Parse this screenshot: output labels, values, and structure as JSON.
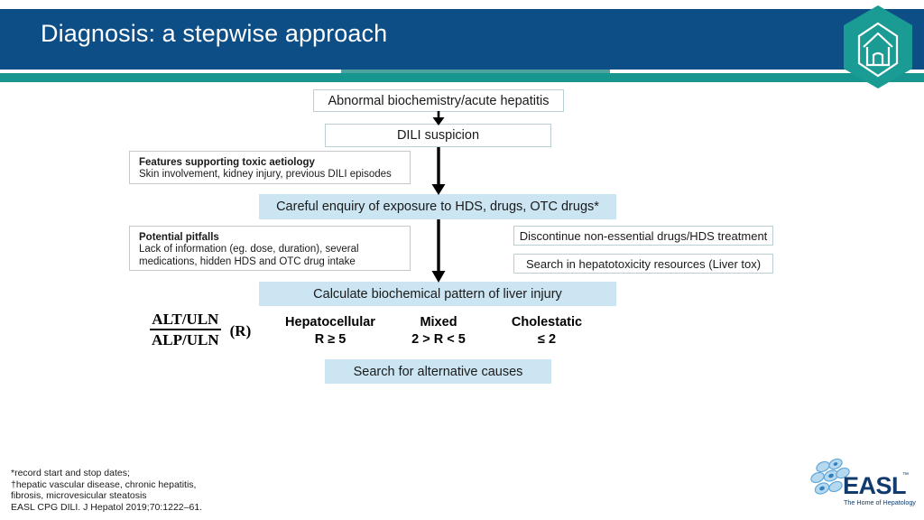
{
  "header": {
    "title": "Diagnosis: a stepwise approach",
    "bar_color": "#0d4e86",
    "band_color": "#17958f",
    "logo_name": "easl-hexagon-house-logo"
  },
  "flow": {
    "abnormal": "Abnormal biochemistry/acute hepatitis",
    "dili_suspicion": "DILI suspicion",
    "enquiry": "Careful enquiry of exposure to HDS, drugs, OTC drugs*",
    "calculate": "Calculate biochemical pattern of liver injury",
    "alternative_causes": "Search for alternative causes",
    "accent_blue": "#cce5f2"
  },
  "notes": {
    "features": {
      "title": "Features supporting toxic aetiology",
      "body": "Skin involvement, kidney injury, previous DILI episodes"
    },
    "pitfalls": {
      "title": "Potential pitfalls",
      "body": "Lack of information (eg. dose, duration), several medications, hidden HDS and OTC drug intake"
    }
  },
  "actions": {
    "discontinue": "Discontinue non-essential drugs/HDS treatment",
    "search_resources": "Search in hepatotoxicity resources (Liver tox)"
  },
  "r_ratio": {
    "numerator": "ALT/ULN",
    "denominator": "ALP/ULN",
    "label": "(R)"
  },
  "patterns": [
    {
      "name": "Hepatocellular",
      "rule": "R ≥ 5"
    },
    {
      "name": "Mixed",
      "rule": "2 > R < 5"
    },
    {
      "name": "Cholestatic",
      "rule": "≤ 2"
    }
  ],
  "footnotes": [
    "*record start and stop dates;",
    "†hepatic vascular disease, chronic hepatitis,",
    "fibrosis, microvesicular steatosis",
    "EASL CPG DILI. J Hepatol 2019;70:1222–61."
  ],
  "easl_logo": {
    "wordmark": "EASL",
    "trademark": "™",
    "tagline": "The Home of Hepatology",
    "color": "#123b6d"
  }
}
